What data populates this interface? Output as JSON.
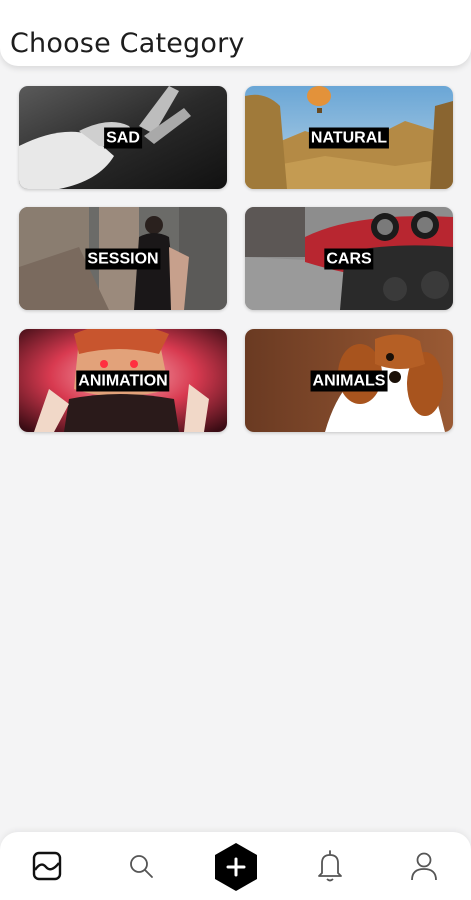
{
  "header": {
    "title": "Choose Category"
  },
  "categories": [
    {
      "label": "SAD"
    },
    {
      "label": "NATURAL"
    },
    {
      "label": "SESSION"
    },
    {
      "label": "CARS"
    },
    {
      "label": "ANIMATION"
    },
    {
      "label": "ANIMALS"
    }
  ],
  "bottom_nav": {
    "items": [
      {
        "icon": "gallery-icon",
        "active": true
      },
      {
        "icon": "search-icon",
        "active": false
      },
      {
        "icon": "plus-icon",
        "active": false
      },
      {
        "icon": "bell-icon",
        "active": false
      },
      {
        "icon": "profile-icon",
        "active": false
      }
    ]
  }
}
